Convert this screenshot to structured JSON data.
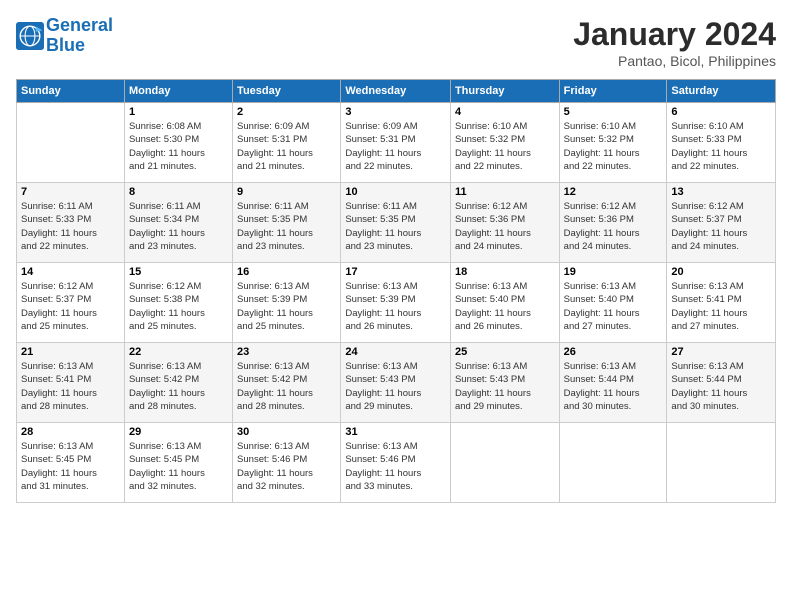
{
  "logo": {
    "line1": "General",
    "line2": "Blue"
  },
  "title": "January 2024",
  "subtitle": "Pantao, Bicol, Philippines",
  "days_header": [
    "Sunday",
    "Monday",
    "Tuesday",
    "Wednesday",
    "Thursday",
    "Friday",
    "Saturday"
  ],
  "weeks": [
    [
      {
        "num": "",
        "info": ""
      },
      {
        "num": "1",
        "info": "Sunrise: 6:08 AM\nSunset: 5:30 PM\nDaylight: 11 hours\nand 21 minutes."
      },
      {
        "num": "2",
        "info": "Sunrise: 6:09 AM\nSunset: 5:31 PM\nDaylight: 11 hours\nand 21 minutes."
      },
      {
        "num": "3",
        "info": "Sunrise: 6:09 AM\nSunset: 5:31 PM\nDaylight: 11 hours\nand 22 minutes."
      },
      {
        "num": "4",
        "info": "Sunrise: 6:10 AM\nSunset: 5:32 PM\nDaylight: 11 hours\nand 22 minutes."
      },
      {
        "num": "5",
        "info": "Sunrise: 6:10 AM\nSunset: 5:32 PM\nDaylight: 11 hours\nand 22 minutes."
      },
      {
        "num": "6",
        "info": "Sunrise: 6:10 AM\nSunset: 5:33 PM\nDaylight: 11 hours\nand 22 minutes."
      }
    ],
    [
      {
        "num": "7",
        "info": "Sunrise: 6:11 AM\nSunset: 5:33 PM\nDaylight: 11 hours\nand 22 minutes."
      },
      {
        "num": "8",
        "info": "Sunrise: 6:11 AM\nSunset: 5:34 PM\nDaylight: 11 hours\nand 23 minutes."
      },
      {
        "num": "9",
        "info": "Sunrise: 6:11 AM\nSunset: 5:35 PM\nDaylight: 11 hours\nand 23 minutes."
      },
      {
        "num": "10",
        "info": "Sunrise: 6:11 AM\nSunset: 5:35 PM\nDaylight: 11 hours\nand 23 minutes."
      },
      {
        "num": "11",
        "info": "Sunrise: 6:12 AM\nSunset: 5:36 PM\nDaylight: 11 hours\nand 24 minutes."
      },
      {
        "num": "12",
        "info": "Sunrise: 6:12 AM\nSunset: 5:36 PM\nDaylight: 11 hours\nand 24 minutes."
      },
      {
        "num": "13",
        "info": "Sunrise: 6:12 AM\nSunset: 5:37 PM\nDaylight: 11 hours\nand 24 minutes."
      }
    ],
    [
      {
        "num": "14",
        "info": "Sunrise: 6:12 AM\nSunset: 5:37 PM\nDaylight: 11 hours\nand 25 minutes."
      },
      {
        "num": "15",
        "info": "Sunrise: 6:12 AM\nSunset: 5:38 PM\nDaylight: 11 hours\nand 25 minutes."
      },
      {
        "num": "16",
        "info": "Sunrise: 6:13 AM\nSunset: 5:39 PM\nDaylight: 11 hours\nand 25 minutes."
      },
      {
        "num": "17",
        "info": "Sunrise: 6:13 AM\nSunset: 5:39 PM\nDaylight: 11 hours\nand 26 minutes."
      },
      {
        "num": "18",
        "info": "Sunrise: 6:13 AM\nSunset: 5:40 PM\nDaylight: 11 hours\nand 26 minutes."
      },
      {
        "num": "19",
        "info": "Sunrise: 6:13 AM\nSunset: 5:40 PM\nDaylight: 11 hours\nand 27 minutes."
      },
      {
        "num": "20",
        "info": "Sunrise: 6:13 AM\nSunset: 5:41 PM\nDaylight: 11 hours\nand 27 minutes."
      }
    ],
    [
      {
        "num": "21",
        "info": "Sunrise: 6:13 AM\nSunset: 5:41 PM\nDaylight: 11 hours\nand 28 minutes."
      },
      {
        "num": "22",
        "info": "Sunrise: 6:13 AM\nSunset: 5:42 PM\nDaylight: 11 hours\nand 28 minutes."
      },
      {
        "num": "23",
        "info": "Sunrise: 6:13 AM\nSunset: 5:42 PM\nDaylight: 11 hours\nand 28 minutes."
      },
      {
        "num": "24",
        "info": "Sunrise: 6:13 AM\nSunset: 5:43 PM\nDaylight: 11 hours\nand 29 minutes."
      },
      {
        "num": "25",
        "info": "Sunrise: 6:13 AM\nSunset: 5:43 PM\nDaylight: 11 hours\nand 29 minutes."
      },
      {
        "num": "26",
        "info": "Sunrise: 6:13 AM\nSunset: 5:44 PM\nDaylight: 11 hours\nand 30 minutes."
      },
      {
        "num": "27",
        "info": "Sunrise: 6:13 AM\nSunset: 5:44 PM\nDaylight: 11 hours\nand 30 minutes."
      }
    ],
    [
      {
        "num": "28",
        "info": "Sunrise: 6:13 AM\nSunset: 5:45 PM\nDaylight: 11 hours\nand 31 minutes."
      },
      {
        "num": "29",
        "info": "Sunrise: 6:13 AM\nSunset: 5:45 PM\nDaylight: 11 hours\nand 32 minutes."
      },
      {
        "num": "30",
        "info": "Sunrise: 6:13 AM\nSunset: 5:46 PM\nDaylight: 11 hours\nand 32 minutes."
      },
      {
        "num": "31",
        "info": "Sunrise: 6:13 AM\nSunset: 5:46 PM\nDaylight: 11 hours\nand 33 minutes."
      },
      {
        "num": "",
        "info": ""
      },
      {
        "num": "",
        "info": ""
      },
      {
        "num": "",
        "info": ""
      }
    ]
  ]
}
